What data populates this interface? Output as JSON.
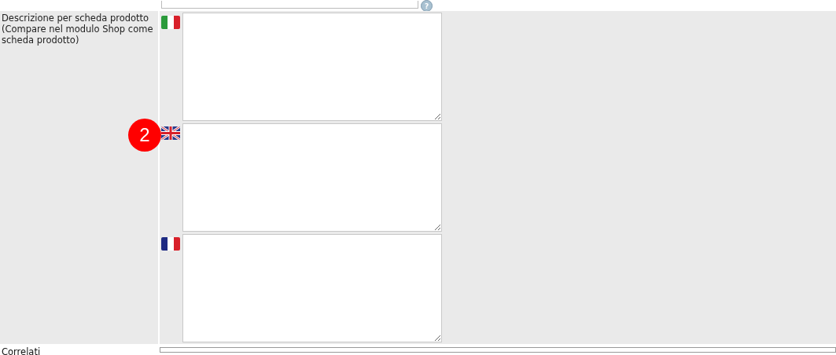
{
  "top_field": {
    "help": "?"
  },
  "description_row": {
    "label": "Descrizione per scheda prodotto (Compare nel modulo Shop come scheda prodotto)",
    "languages": [
      {
        "kind": "italian"
      },
      {
        "kind": "english",
        "badge": "2"
      },
      {
        "kind": "french"
      }
    ]
  },
  "next_row": {
    "label": "Correlati"
  }
}
